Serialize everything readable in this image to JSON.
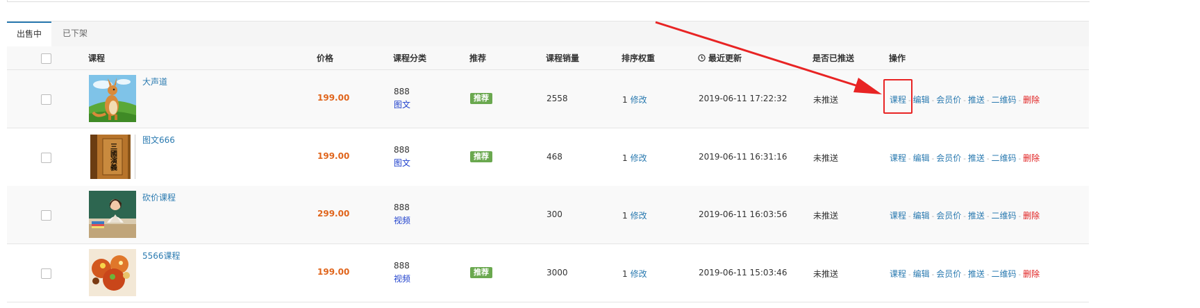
{
  "tabs": [
    {
      "label": "出售中",
      "active": true
    },
    {
      "label": "已下架",
      "active": false
    }
  ],
  "columns": {
    "course": "课程",
    "price": "价格",
    "category": "课程分类",
    "recommend": "推荐",
    "sales": "课程销量",
    "sort_weight": "排序权重",
    "updated": "最近更新",
    "pushed": "是否已推送",
    "actions": "操作"
  },
  "row_actions": {
    "course": "课程",
    "edit": "编辑",
    "member_price": "会员价",
    "push": "推送",
    "qrcode": "二维码",
    "delete": "删除",
    "separator": "-",
    "edit_weight": "修改"
  },
  "rows": [
    {
      "title": "大声道",
      "price": "199.00",
      "category_code": "888",
      "category_type": "图文",
      "recommend": "推荐",
      "sales": "2558",
      "weight": "1",
      "updated": "2019-06-11 17:22:32",
      "push_status": "未推送",
      "thumb": "kangaroo-cartoon"
    },
    {
      "title": "图文666",
      "price": "199.00",
      "category_code": "888",
      "category_type": "图文",
      "recommend": "推荐",
      "sales": "468",
      "weight": "1",
      "updated": "2019-06-11 16:31:16",
      "push_status": "未推送",
      "thumb": "book-cover",
      "book_text": "三國演義"
    },
    {
      "title": "砍价课程",
      "price": "299.00",
      "category_code": "888",
      "category_type": "视频",
      "recommend": "",
      "sales": "300",
      "weight": "1",
      "updated": "2019-06-11 16:03:56",
      "push_status": "未推送",
      "thumb": "teacher-photo"
    },
    {
      "title": "5566课程",
      "price": "199.00",
      "category_code": "888",
      "category_type": "视频",
      "recommend": "推荐",
      "sales": "3000",
      "weight": "1",
      "updated": "2019-06-11 15:03:46",
      "push_status": "未推送",
      "thumb": "food-photo"
    }
  ],
  "icons": {
    "clock": "clock-icon"
  },
  "colors": {
    "link": "#2a7ab0",
    "price": "#e0651c",
    "badge": "#6aa84f",
    "delete": "#e02020",
    "category_type": "#1d3fcc",
    "annotation": "#e82424"
  }
}
